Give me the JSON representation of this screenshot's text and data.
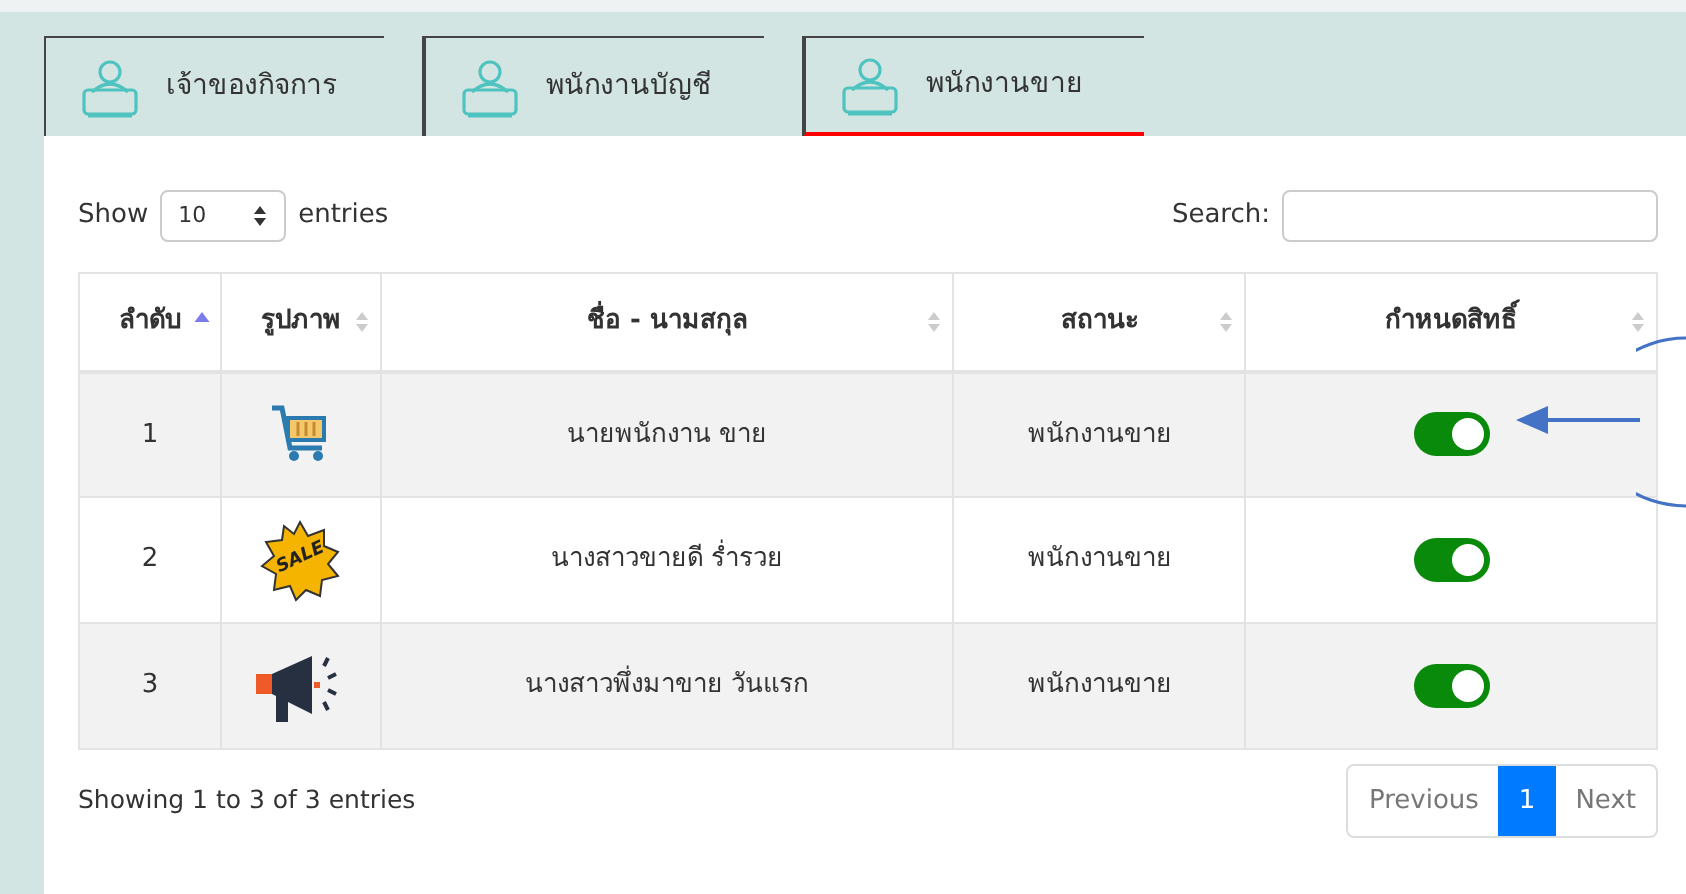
{
  "tabs": [
    {
      "label": "เจ้าของกิจการ",
      "selected": false
    },
    {
      "label": "พนักงานบัญชี",
      "selected": false
    },
    {
      "label": "พนักงานขาย",
      "selected": true
    }
  ],
  "length_control": {
    "prefix": "Show",
    "value": "10",
    "suffix": "entries"
  },
  "search": {
    "label": "Search:"
  },
  "table": {
    "columns": [
      {
        "label": "ลำดับ",
        "sorted": true
      },
      {
        "label": "รูปภาพ",
        "sorted": false
      },
      {
        "label": "ชื่อ - นามสกุล",
        "sorted": false
      },
      {
        "label": "สถานะ",
        "sorted": false
      },
      {
        "label": "กำหนดสิทธิ์",
        "sorted": false
      }
    ],
    "rows": [
      {
        "no": "1",
        "picture": {
          "kind": "cart"
        },
        "name": "นายพนักงาน ขาย",
        "status": "พนักงานขาย",
        "on": true
      },
      {
        "no": "2",
        "picture": {
          "kind": "sale",
          "label": "SALE"
        },
        "name": "นางสาวขายดี ร่ำรวย",
        "status": "พนักงานขาย",
        "on": true
      },
      {
        "no": "3",
        "picture": {
          "kind": "megaphone"
        },
        "name": "นางสาวพึ่งมาขาย วันแรก",
        "status": "พนักงานขาย",
        "on": true
      }
    ]
  },
  "info": "Showing 1 to 3 of 3 entries",
  "pagination": [
    {
      "label": "Previous",
      "selected": false
    },
    {
      "label": "1",
      "selected": true
    },
    {
      "label": "Next",
      "selected": false
    }
  ]
}
